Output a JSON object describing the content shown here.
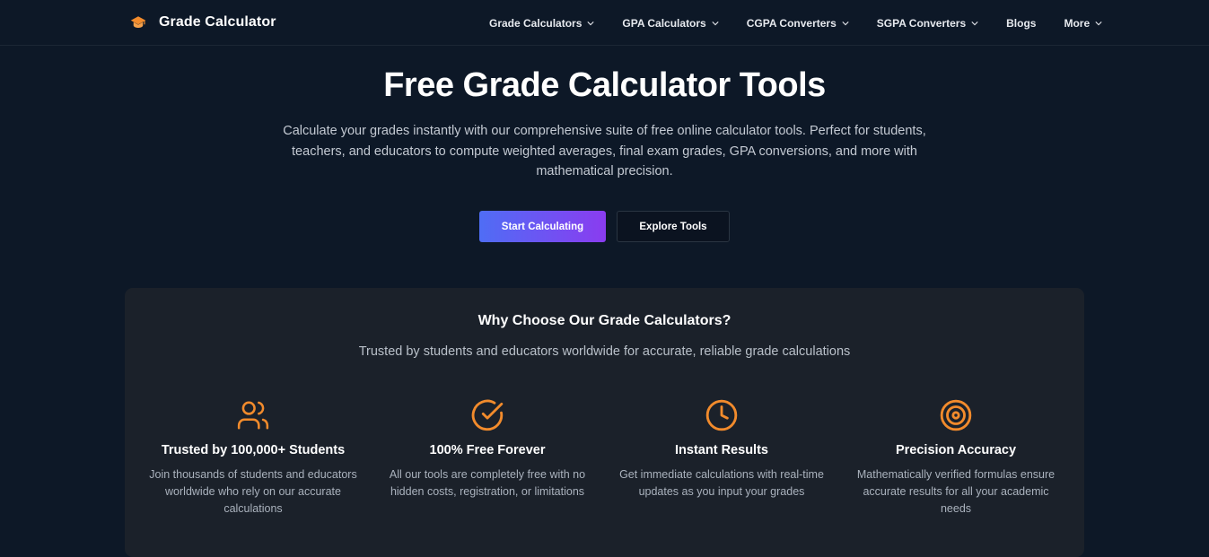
{
  "brand": {
    "name": "Grade Calculator",
    "icon": "graduation-cap-icon",
    "icon_color": "#f28b2c"
  },
  "nav": {
    "items": [
      {
        "label": "Grade Calculators",
        "dropdown": true
      },
      {
        "label": "GPA Calculators",
        "dropdown": true
      },
      {
        "label": "CGPA Converters",
        "dropdown": true
      },
      {
        "label": "SGPA Converters",
        "dropdown": true
      },
      {
        "label": "Blogs",
        "dropdown": false
      },
      {
        "label": "More",
        "dropdown": true
      }
    ]
  },
  "hero": {
    "title": "Free Grade Calculator Tools",
    "description": "Calculate your grades instantly with our comprehensive suite of free online calculator tools. Perfect for students, teachers, and educators to compute weighted averages, final exam grades, GPA conversions, and more with mathematical precision.",
    "primary_button": "Start Calculating",
    "secondary_button": "Explore Tools"
  },
  "features": {
    "title": "Why Choose Our Grade Calculators?",
    "subtitle": "Trusted by students and educators worldwide for accurate, reliable grade calculations",
    "items": [
      {
        "icon": "users-icon",
        "title": "Trusted by 100,000+ Students",
        "description": "Join thousands of students and educators worldwide who rely on our accurate calculations"
      },
      {
        "icon": "check-circle-icon",
        "title": "100% Free Forever",
        "description": "All our tools are completely free with no hidden costs, registration, or limitations"
      },
      {
        "icon": "clock-icon",
        "title": "Instant Results",
        "description": "Get immediate calculations with real-time updates as you input your grades"
      },
      {
        "icon": "target-icon",
        "title": "Precision Accuracy",
        "description": "Mathematically verified formulas ensure accurate results for all your academic needs"
      }
    ]
  },
  "colors": {
    "background": "#0d1827",
    "panel": "#1b212a",
    "accent": "#f28b2c",
    "gradient_start": "#4f6df5",
    "gradient_end": "#8a3cf0"
  }
}
